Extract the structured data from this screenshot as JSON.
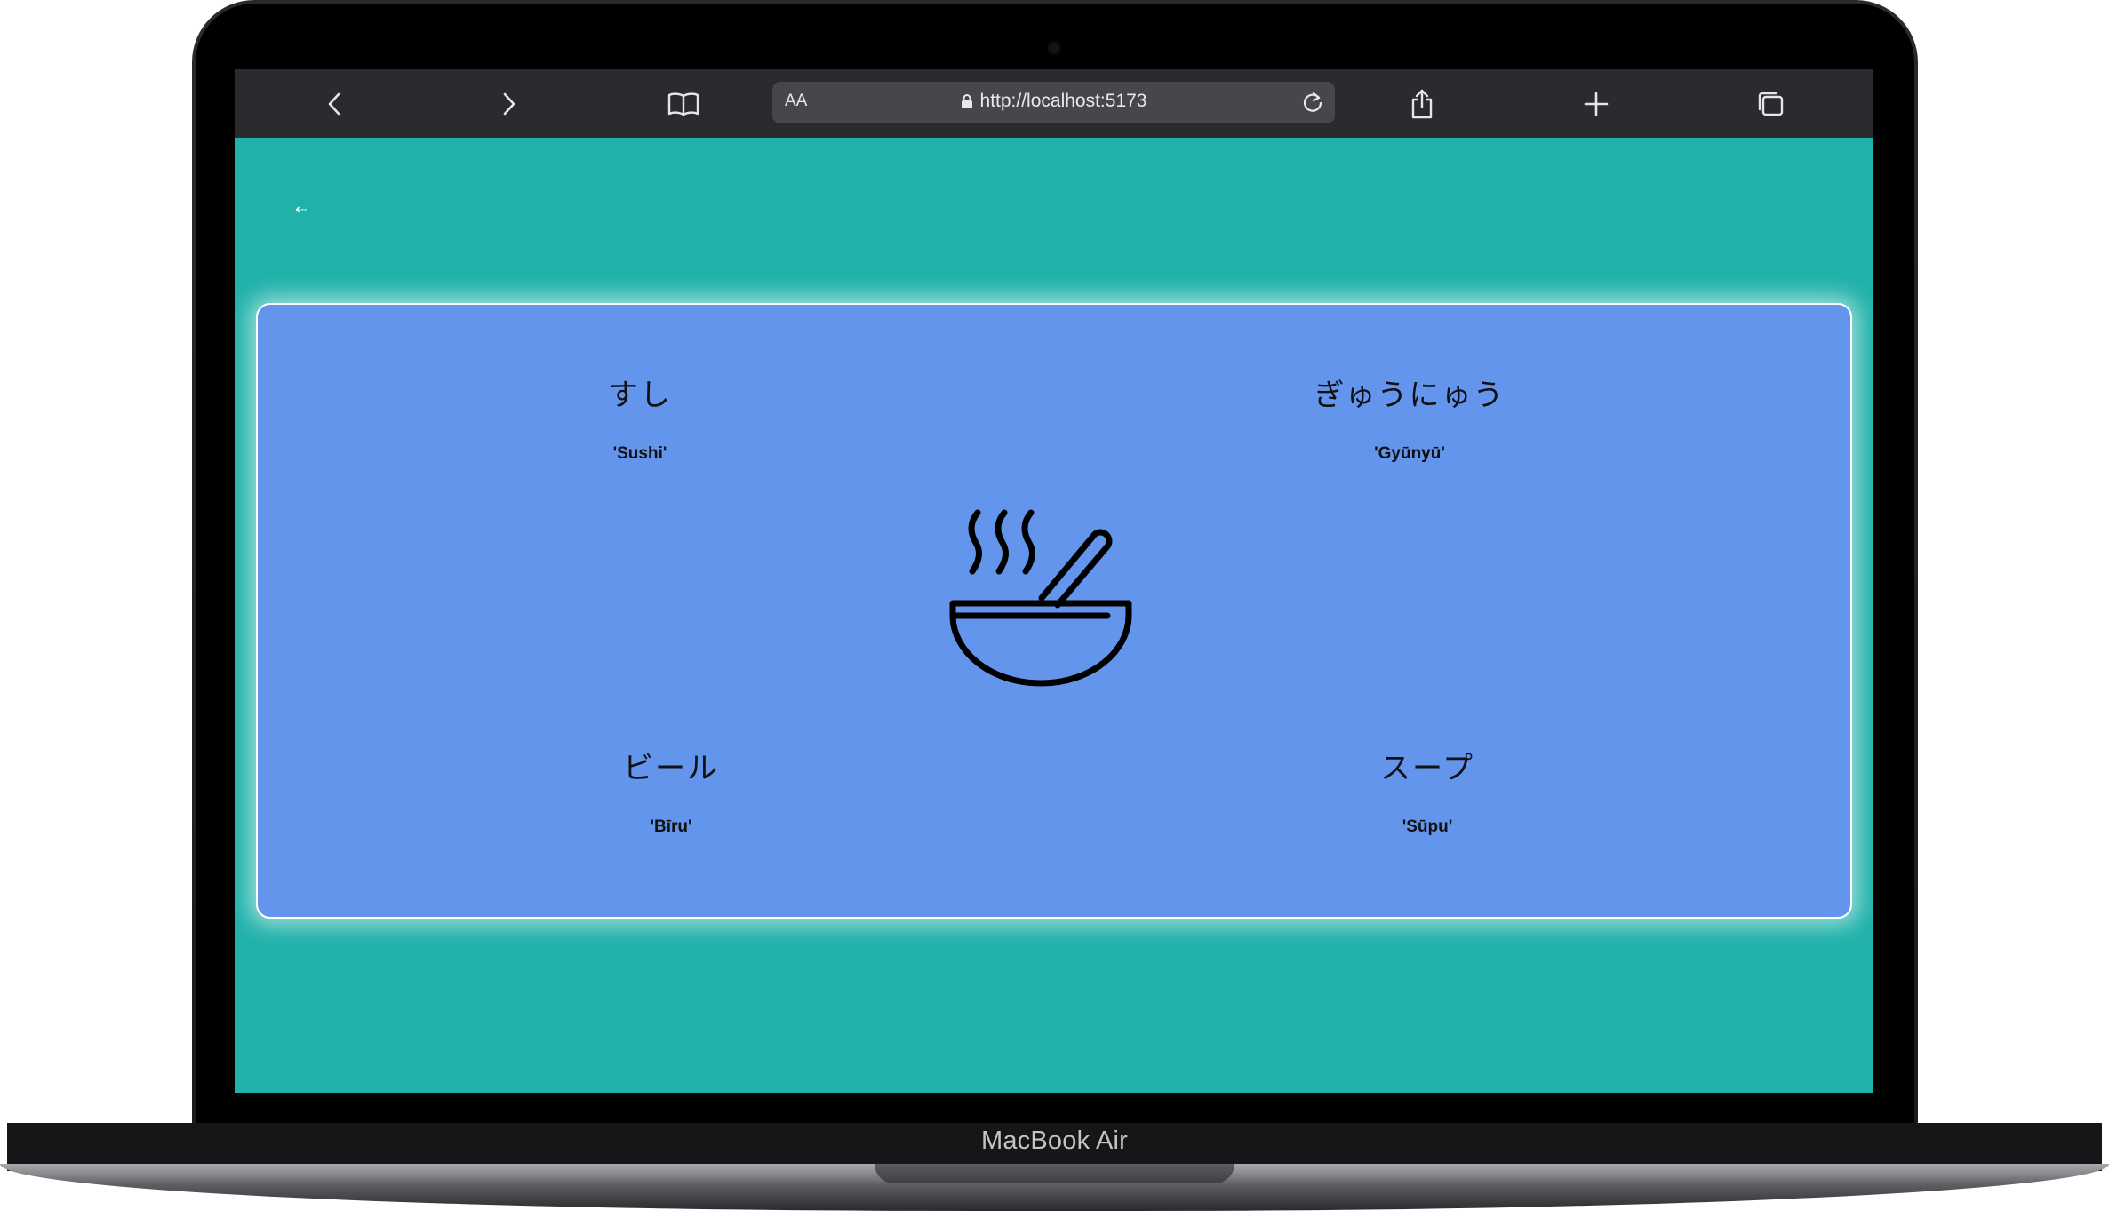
{
  "device": {
    "brand_label": "MacBook Air"
  },
  "browser": {
    "reader_label": "AA",
    "url": "http://localhost:5173",
    "icons": [
      "back-icon",
      "forward-icon",
      "bookmarks-icon",
      "lock-icon",
      "reload-icon",
      "share-icon",
      "new-tab-icon",
      "tabs-icon"
    ]
  },
  "page": {
    "background_color": "#20b2aa",
    "card_color": "#6495ed",
    "back_link": "⇠",
    "words": [
      {
        "jp": "すし",
        "romaji": "'Sushi'"
      },
      {
        "jp": "ぎゅうにゅう",
        "romaji": "'Gyūnyū'"
      },
      {
        "jp": "ビール",
        "romaji": "'Bīru'"
      },
      {
        "jp": "スープ",
        "romaji": "'Sūpu'"
      }
    ],
    "center_icon": "food-bowl-icon"
  }
}
